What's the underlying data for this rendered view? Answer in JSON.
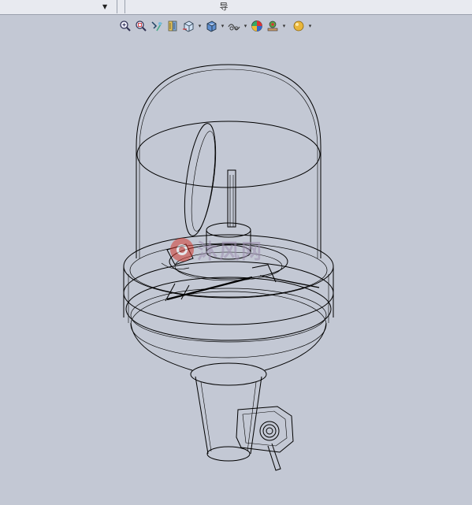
{
  "top_bar": {
    "center_icon": "导",
    "dropdown_arrow": "▼"
  },
  "toolbar": {
    "tools": [
      {
        "id": "zoom-to-fit",
        "icon": "zoom-to-fit-icon"
      },
      {
        "id": "zoom-to-area",
        "icon": "zoom-to-area-icon"
      },
      {
        "id": "previous-view",
        "icon": "previous-view-icon"
      },
      {
        "id": "section-view",
        "icon": "section-view-icon"
      },
      {
        "id": "view-orientation",
        "icon": "view-orientation-icon",
        "dropdown": true
      },
      {
        "id": "display-style",
        "icon": "display-style-icon",
        "dropdown": true
      },
      {
        "id": "hide-show-items",
        "icon": "hide-show-items-icon",
        "dropdown": true
      },
      {
        "id": "edit-appearance",
        "icon": "edit-appearance-icon"
      },
      {
        "id": "apply-scene",
        "icon": "apply-scene-icon",
        "dropdown": true
      },
      {
        "id": "view-settings",
        "icon": "view-settings-icon",
        "dropdown": true
      }
    ]
  },
  "watermark": {
    "text": "沐风网",
    "logo": "mufeng-logo"
  },
  "colors": {
    "background": "#c3c8d4",
    "wireframe": "#000000"
  }
}
